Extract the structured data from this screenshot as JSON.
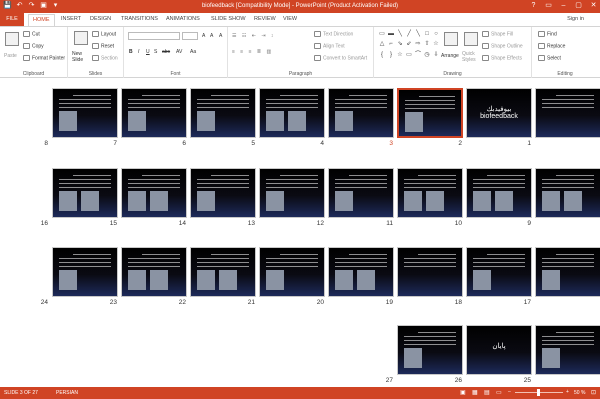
{
  "window": {
    "title": "biofeedback [Compatibility Mode] - PowerPoint (Product Activation Failed)",
    "controls": [
      "?",
      "▭",
      "–",
      "▢",
      "✕"
    ]
  },
  "qat": [
    "💾",
    "↶",
    "↷",
    "▣",
    "▾"
  ],
  "tabs": {
    "file": "FILE",
    "items": [
      "HOME",
      "INSERT",
      "DESIGN",
      "TRANSITIONS",
      "ANIMATIONS",
      "SLIDE SHOW",
      "REVIEW",
      "VIEW"
    ],
    "active": "HOME",
    "sign_in": "Sign in"
  },
  "ribbon": {
    "clipboard": {
      "label": "Clipboard",
      "paste": "Paste",
      "cut": "Cut",
      "copy": "Copy",
      "format_painter": "Format Painter"
    },
    "slides": {
      "label": "Slides",
      "new_slide": "New Slide",
      "layout": "Layout",
      "reset": "Reset",
      "section": "Section"
    },
    "font": {
      "label": "Font",
      "buttons": [
        "B",
        "I",
        "U",
        "S",
        "abc",
        "AV",
        "Aa",
        "A",
        "A",
        "A"
      ]
    },
    "paragraph": {
      "label": "Paragraph",
      "text_direction": "Text Direction",
      "align_text": "Align Text",
      "convert_smartart": "Convert to SmartArt"
    },
    "drawing": {
      "label": "Drawing",
      "arrange": "Arrange",
      "quick_styles": "Quick Styles",
      "shape_fill": "Shape Fill",
      "shape_outline": "Shape Outline",
      "shape_effects": "Shape Effects",
      "shapes": [
        "▭",
        "▬",
        "╲",
        "╱",
        "╲",
        "□",
        "○",
        "△",
        "⌐",
        "⇘",
        "⇙",
        "⇨",
        "⇧",
        "☆",
        "{",
        "}",
        "☆",
        "▭",
        "⌒",
        "◷",
        "⇩"
      ]
    },
    "editing": {
      "label": "Editing",
      "find": "Find",
      "replace": "Replace",
      "select": "Select"
    }
  },
  "slides": [
    {
      "num": "1",
      "selected": false,
      "text": "",
      "photos": 0
    },
    {
      "num": "2",
      "selected": false,
      "text": "بيوفيدبك biofeedback",
      "photos": 0
    },
    {
      "num": "3",
      "selected": true,
      "text": "",
      "photos": 1
    },
    {
      "num": "4",
      "selected": false,
      "text": "",
      "photos": 1
    },
    {
      "num": "5",
      "selected": false,
      "text": "",
      "photos": 2
    },
    {
      "num": "6",
      "selected": false,
      "text": "",
      "photos": 1
    },
    {
      "num": "7",
      "selected": false,
      "text": "",
      "photos": 1
    },
    {
      "num": "8",
      "selected": false,
      "text": "",
      "photos": 1
    },
    {
      "num": "9",
      "selected": false,
      "text": "",
      "photos": 2
    },
    {
      "num": "10",
      "selected": false,
      "text": "",
      "photos": 2
    },
    {
      "num": "11",
      "selected": false,
      "text": "",
      "photos": 2
    },
    {
      "num": "12",
      "selected": false,
      "text": "",
      "photos": 1
    },
    {
      "num": "13",
      "selected": false,
      "text": "",
      "photos": 1
    },
    {
      "num": "14",
      "selected": false,
      "text": "",
      "photos": 1
    },
    {
      "num": "15",
      "selected": false,
      "text": "",
      "photos": 2
    },
    {
      "num": "16",
      "selected": false,
      "text": "",
      "photos": 2
    },
    {
      "num": "17",
      "selected": false,
      "text": "",
      "photos": 1
    },
    {
      "num": "18",
      "selected": false,
      "text": "",
      "photos": 1
    },
    {
      "num": "19",
      "selected": false,
      "text": "",
      "photos": 0
    },
    {
      "num": "20",
      "selected": false,
      "text": "",
      "photos": 2
    },
    {
      "num": "21",
      "selected": false,
      "text": "",
      "photos": 1
    },
    {
      "num": "22",
      "selected": false,
      "text": "",
      "photos": 2
    },
    {
      "num": "23",
      "selected": false,
      "text": "",
      "photos": 2
    },
    {
      "num": "24",
      "selected": false,
      "text": "",
      "photos": 1
    },
    {
      "num": "25",
      "selected": false,
      "text": "",
      "photos": 1
    },
    {
      "num": "26",
      "selected": false,
      "text": "پايان",
      "photos": 0
    },
    {
      "num": "27",
      "selected": false,
      "text": "",
      "photos": 1
    }
  ],
  "status": {
    "slide_info": "SLIDE 3 OF 27",
    "language": "PERSIAN",
    "zoom": "50 %"
  },
  "colors": {
    "accent": "#d04424",
    "slide_bg": "#000000"
  }
}
